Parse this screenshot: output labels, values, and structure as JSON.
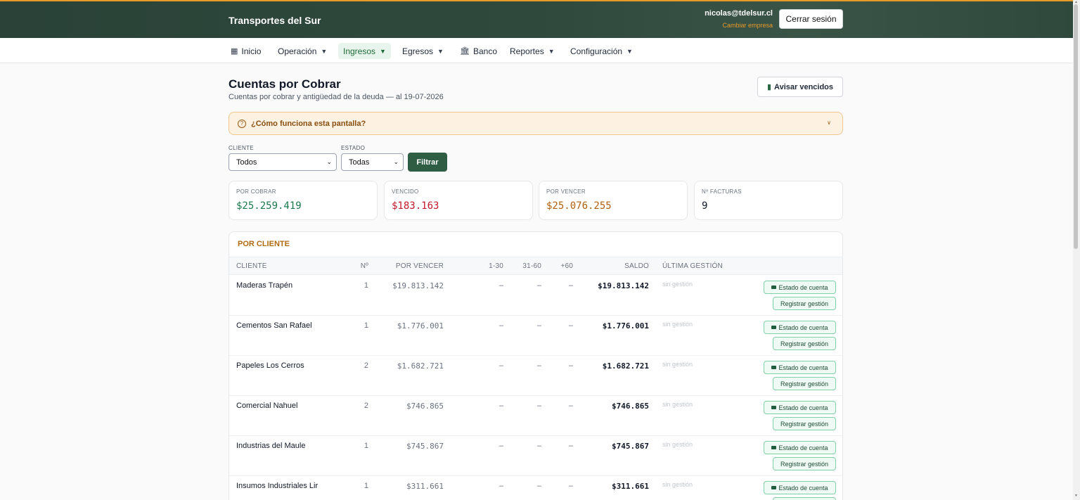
{
  "header": {
    "brand": "Transportes del Sur",
    "user_email": "nicolas@tdelsur.cl",
    "switch_company": "Cambiar empresa",
    "logout": "Cerrar sesión"
  },
  "nav": {
    "items": [
      {
        "label": "Inicio",
        "icon": "grid-icon",
        "dropdown": false
      },
      {
        "label": "Operación",
        "dropdown": true
      },
      {
        "label": "Ingresos",
        "dropdown": true,
        "active": true
      },
      {
        "label": "Egresos",
        "dropdown": true
      },
      {
        "label": "Banco",
        "icon": "bank-icon",
        "dropdown": false
      },
      {
        "label": "Reportes",
        "dropdown": true
      },
      {
        "label": "Configuración",
        "dropdown": true
      }
    ]
  },
  "page": {
    "title": "Cuentas por Cobrar",
    "subtitle": "Cuentas por cobrar y antigüedad de la deuda — al 19-07-2026",
    "notify_button": "Avisar vencidos"
  },
  "help": {
    "text": "¿Cómo funciona esta pantalla?"
  },
  "filters": {
    "cliente_label": "CLIENTE",
    "cliente_value": "Todos",
    "estado_label": "ESTADO",
    "estado_value": "Todas",
    "filter_button": "Filtrar"
  },
  "kpis": [
    {
      "label": "POR COBRAR",
      "value": "$25.259.419",
      "color": "#1a7a4c"
    },
    {
      "label": "VENCIDO",
      "value": "$183.163",
      "color": "#c2182b"
    },
    {
      "label": "POR VENCER",
      "value": "$25.076.255",
      "color": "#b0600c"
    },
    {
      "label": "Nº FACTURAS",
      "value": "9",
      "color": "#111827"
    }
  ],
  "table": {
    "title": "POR CLIENTE",
    "columns": [
      "CLIENTE",
      "Nº",
      "POR VENCER",
      "1-30",
      "31-60",
      "+60",
      "SALDO",
      "ÚLTIMA GESTIÓN"
    ],
    "action_edo": "Estado de cuenta",
    "action_reg": "Registrar gestión",
    "rows": [
      {
        "cliente": "Maderas Trapén",
        "n": "1",
        "por_vencer": "$19.813.142",
        "d1": "–",
        "d2": "–",
        "d3": "–",
        "saldo": "$19.813.142",
        "gestion": "sin gestión"
      },
      {
        "cliente": "Cementos San Rafael",
        "n": "1",
        "por_vencer": "$1.776.001",
        "d1": "–",
        "d2": "–",
        "d3": "–",
        "saldo": "$1.776.001",
        "gestion": "sin gestión"
      },
      {
        "cliente": "Papeles Los Cerros",
        "n": "2",
        "por_vencer": "$1.682.721",
        "d1": "–",
        "d2": "–",
        "d3": "–",
        "saldo": "$1.682.721",
        "gestion": "sin gestión"
      },
      {
        "cliente": "Comercial Nahuel",
        "n": "2",
        "por_vencer": "$746.865",
        "d1": "–",
        "d2": "–",
        "d3": "–",
        "saldo": "$746.865",
        "gestion": "sin gestión"
      },
      {
        "cliente": "Industrias del Maule",
        "n": "1",
        "por_vencer": "$745.867",
        "d1": "–",
        "d2": "–",
        "d3": "–",
        "saldo": "$745.867",
        "gestion": "sin gestión"
      },
      {
        "cliente": "Insumos Industriales Lir",
        "n": "1",
        "por_vencer": "$311.661",
        "d1": "–",
        "d2": "–",
        "d3": "–",
        "saldo": "$311.661",
        "gestion": "sin gestión"
      }
    ]
  }
}
